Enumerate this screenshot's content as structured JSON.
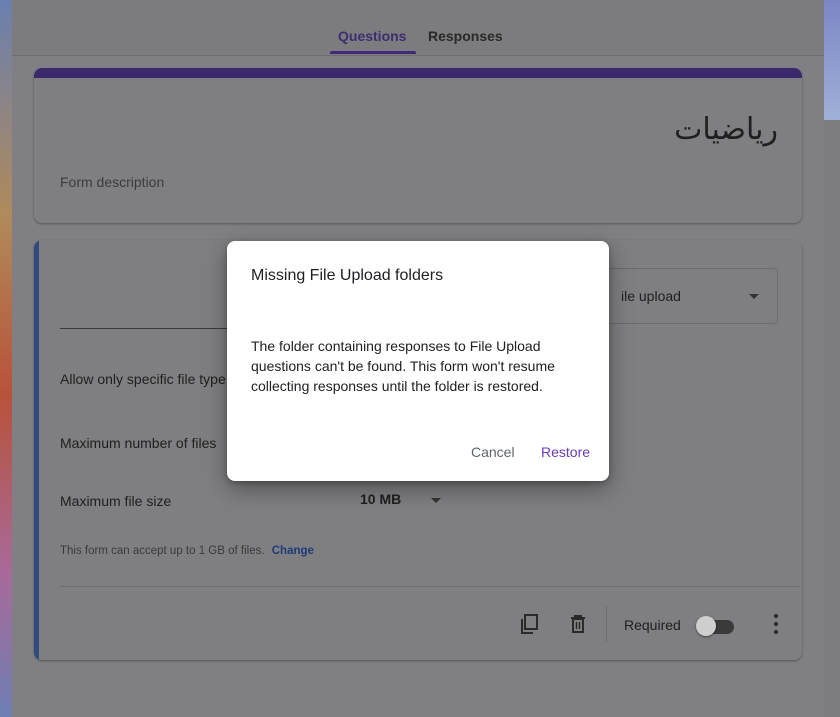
{
  "tabs": {
    "questions": "Questions",
    "responses": "Responses"
  },
  "form": {
    "title": "رياضيات",
    "description_placeholder": "Form description"
  },
  "question": {
    "type_label": "ile upload",
    "allow_types_label": "Allow only specific file type",
    "max_files_label": "Maximum number of files",
    "max_size_label": "Maximum file size",
    "max_size_value": "10 MB",
    "note": "This form can accept up to 1 GB of files.",
    "note_link": "Change",
    "required_label": "Required",
    "required_on": false
  },
  "dialog": {
    "title": "Missing File Upload folders",
    "body": "The folder containing responses to File Upload questions can't be found. This form won't resume collecting responses until the folder is restored.",
    "cancel_label": "Cancel",
    "restore_label": "Restore"
  },
  "icons": {
    "duplicate": "copy-icon",
    "delete": "trash-icon",
    "more": "more-vert-icon",
    "dropdown": "caret-down-icon"
  },
  "colors": {
    "accent": "#673ab7",
    "form_header": "#3a2a6b",
    "question_bar": "#2f4a7e",
    "link": "#1e3a78"
  }
}
